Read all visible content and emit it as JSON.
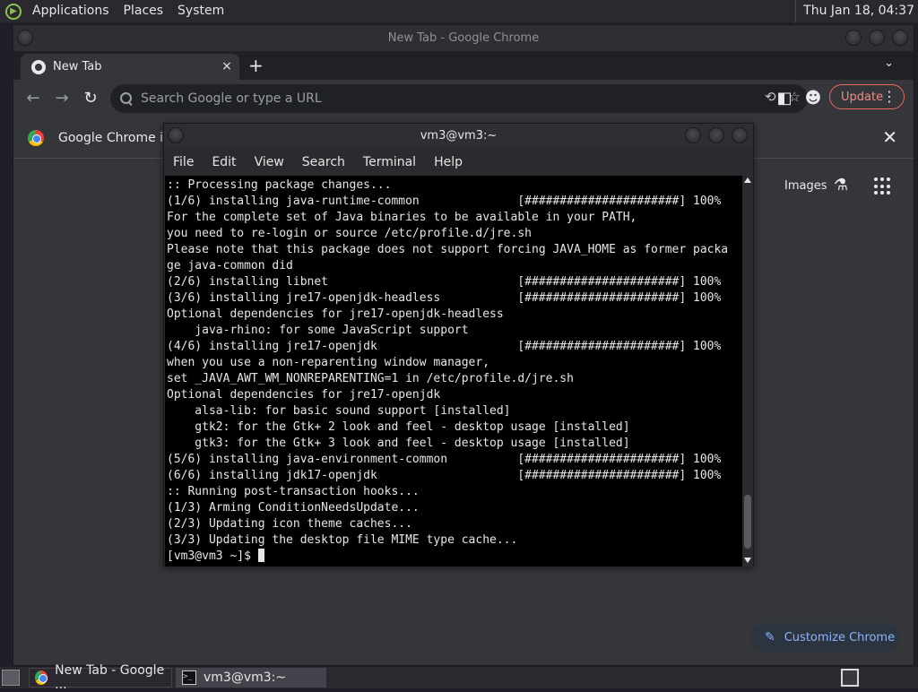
{
  "top_panel": {
    "menu": [
      "Applications",
      "Places",
      "System"
    ],
    "clock": "Thu Jan 18, 04:37"
  },
  "chrome": {
    "window_title": "New Tab - Google Chrome",
    "tab_title": "New Tab",
    "new_tab_symbol": "+",
    "tab_close_symbol": "×",
    "omnibox_placeholder": "Search Google or type a URL",
    "update_label": "Update",
    "info_bar_text": "Google Chrome isn",
    "ntp_images_label": "Images",
    "customize_label": "Customize Chrome",
    "icons": {
      "back": "back-arrow-icon",
      "forward": "forward-arrow-icon",
      "reload": "reload-icon",
      "share": "share-icon",
      "bookmark": "star-icon",
      "sidepanel": "side-panel-icon",
      "profile": "profile-icon",
      "menu": "kebab-menu-icon"
    }
  },
  "terminal": {
    "window_title": "vm3@vm3:~",
    "menu": [
      "File",
      "Edit",
      "View",
      "Search",
      "Terminal",
      "Help"
    ],
    "lines": [
      ":: Processing package changes...",
      "(1/6) installing java-runtime-common              [######################] 100%",
      "For the complete set of Java binaries to be available in your PATH,",
      "you need to re-login or source /etc/profile.d/jre.sh",
      "Please note that this package does not support forcing JAVA_HOME as former packa",
      "ge java-common did",
      "(2/6) installing libnet                           [######################] 100%",
      "(3/6) installing jre17-openjdk-headless           [######################] 100%",
      "Optional dependencies for jre17-openjdk-headless",
      "    java-rhino: for some JavaScript support",
      "(4/6) installing jre17-openjdk                    [######################] 100%",
      "when you use a non-reparenting window manager,",
      "set _JAVA_AWT_WM_NONREPARENTING=1 in /etc/profile.d/jre.sh",
      "Optional dependencies for jre17-openjdk",
      "    alsa-lib: for basic sound support [installed]",
      "    gtk2: for the Gtk+ 2 look and feel - desktop usage [installed]",
      "    gtk3: for the Gtk+ 3 look and feel - desktop usage [installed]",
      "(5/6) installing java-environment-common          [######################] 100%",
      "(6/6) installing jdk17-openjdk                    [######################] 100%",
      ":: Running post-transaction hooks...",
      "(1/3) Arming ConditionNeedsUpdate...",
      "(2/3) Updating icon theme caches...",
      "(3/3) Updating the desktop file MIME type cache..."
    ],
    "prompt": "[vm3@vm3 ~]$ "
  },
  "taskbar": {
    "items": [
      "New Tab - Google ...",
      "vm3@vm3:~"
    ]
  },
  "colors": {
    "panel": "#2b2830",
    "chrome_bg": "#35363a",
    "terminal_bg": "#000000",
    "update_accent": "#f28b82",
    "customize_accent": "#8ab4f8"
  }
}
